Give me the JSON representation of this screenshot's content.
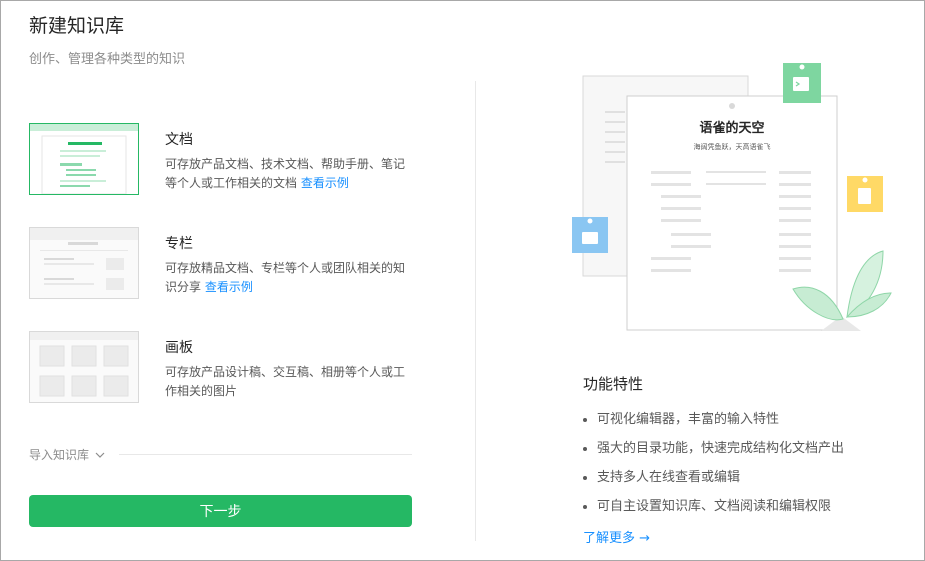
{
  "page": {
    "title": "新建知识库",
    "subtitle": "创作、管理各种类型的知识"
  },
  "types": [
    {
      "name": "文档",
      "desc": "可存放产品文档、技术文档、帮助手册、笔记等个人或工作相关的文档",
      "link": "查看示例",
      "selected": true
    },
    {
      "name": "专栏",
      "desc": "可存放精品文档、专栏等个人或团队相关的知识分享",
      "link": "查看示例",
      "selected": false
    },
    {
      "name": "画板",
      "desc": "可存放产品设计稿、交互稿、相册等个人或工作相关的图片",
      "link": "",
      "selected": false
    }
  ],
  "import": {
    "label": "导入知识库",
    "icon": "chevron-down-icon"
  },
  "next_button": "下一步",
  "illustration": {
    "doc_title": "语雀的天空",
    "doc_subtitle": "海阔凭鱼跃，天高语雀飞"
  },
  "features": {
    "title": "功能特性",
    "items": [
      "可视化编辑器，丰富的输入特性",
      "强大的目录功能，快速完成结构化文档产出",
      "支持多人在线查看或编辑",
      "可自主设置知识库、文档阅读和编辑权限"
    ],
    "more": "了解更多 →"
  },
  "colors": {
    "accent": "#25b864",
    "link": "#1890ff"
  }
}
